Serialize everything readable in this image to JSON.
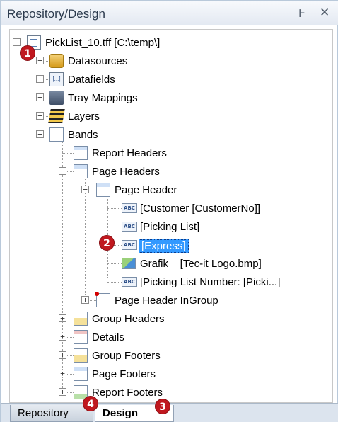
{
  "panel": {
    "title": "Repository/Design",
    "pin_glyph": "Ͱ",
    "close_glyph": "✕"
  },
  "tree": {
    "root": {
      "label": "PickList_10.tff [C:\\temp\\]",
      "icon": "file-icon"
    },
    "items": [
      {
        "label": "Datasources",
        "icon": "database-icon"
      },
      {
        "label": "Datafields",
        "icon": "fields-icon"
      },
      {
        "label": "Tray Mappings",
        "icon": "tray-icon"
      },
      {
        "label": "Layers",
        "icon": "layers-icon"
      },
      {
        "label": "Bands",
        "icon": "page-icon"
      },
      {
        "label": "Report Headers",
        "icon": "page-icon"
      },
      {
        "label": "Page Headers",
        "icon": "page-icon"
      },
      {
        "label": "Page Header",
        "icon": "page-icon"
      },
      {
        "label": "[Customer [CustomerNo]]",
        "icon": "text-field-icon"
      },
      {
        "label": "[Picking List]",
        "icon": "text-field-icon"
      },
      {
        "label": "[Express]",
        "icon": "text-field-icon",
        "selected": true
      },
      {
        "label": "Grafik    [Tec-it Logo.bmp]",
        "icon": "image-icon"
      },
      {
        "label": "[Picking List Number: [Picki...]",
        "icon": "text-field-icon"
      },
      {
        "label": "Page Header InGroup",
        "icon": "page-icon"
      },
      {
        "label": "Group Headers",
        "icon": "page-icon"
      },
      {
        "label": "Details",
        "icon": "page-icon"
      },
      {
        "label": "Group Footers",
        "icon": "page-icon"
      },
      {
        "label": "Page Footers",
        "icon": "page-icon"
      },
      {
        "label": "Report Footers",
        "icon": "page-icon"
      }
    ],
    "abc_text": "ABC"
  },
  "tabs": [
    {
      "label": "Repository",
      "active": false
    },
    {
      "label": "Design",
      "active": true
    }
  ],
  "badges": [
    "1",
    "2",
    "3",
    "4"
  ],
  "colors": {
    "selection": "#3399ff",
    "badge": "#c0181f"
  }
}
